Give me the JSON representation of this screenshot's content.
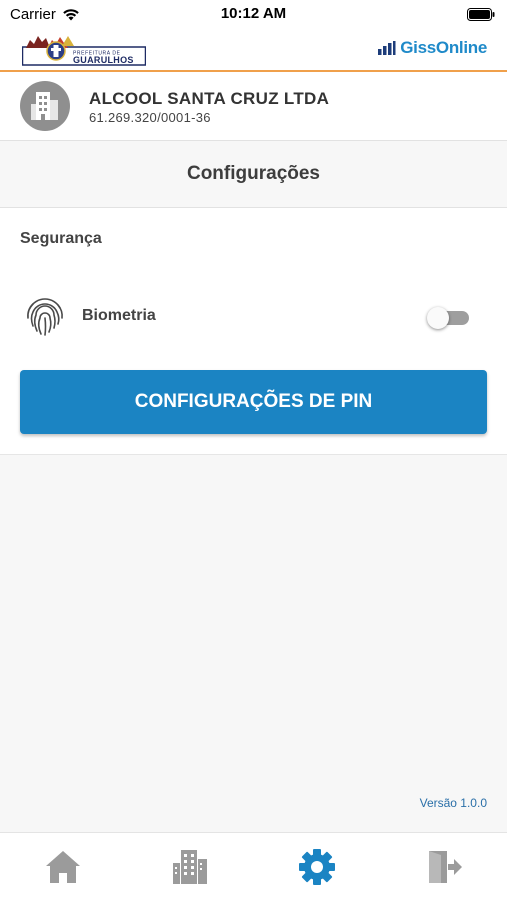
{
  "status_bar": {
    "carrier": "Carrier",
    "time": "10:12 AM"
  },
  "brand": {
    "prefeitura_small": "PREFEITURA DE",
    "prefeitura_city": "GUARULHOS",
    "product_name": "GissOnline"
  },
  "company": {
    "name": "ALCOOL SANTA CRUZ LTDA",
    "cnpj": "61.269.320/0001-36"
  },
  "page": {
    "title": "Configurações"
  },
  "security": {
    "section_title": "Segurança",
    "biometrics_label": "Biometria",
    "biometrics_enabled": false,
    "pin_button_label": "CONFIGURAÇÕES DE PIN"
  },
  "footer": {
    "version": "Versão 1.0.0"
  },
  "tab_bar": {
    "tabs": [
      {
        "icon": "home-icon",
        "active": false
      },
      {
        "icon": "buildings-icon",
        "active": false
      },
      {
        "icon": "gear-icon",
        "active": true
      },
      {
        "icon": "logout-icon",
        "active": false
      }
    ]
  },
  "colors": {
    "primary": "#1b84c3",
    "brand_accent": "#f0a04b",
    "tab_active": "#1b84c3",
    "tab_inactive": "#9b9b9b",
    "version_text": "#2a6fa8"
  }
}
